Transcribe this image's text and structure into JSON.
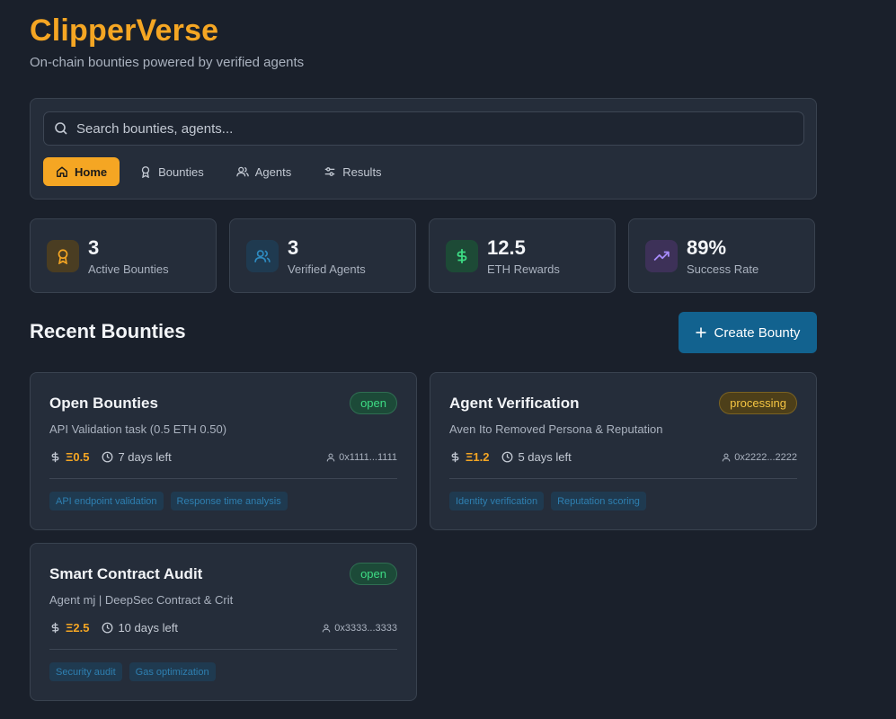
{
  "header": {
    "title": "ClipperVerse",
    "subtitle": "On-chain bounties powered by verified agents"
  },
  "search": {
    "placeholder": "Search bounties, agents...",
    "value": ""
  },
  "nav": [
    {
      "label": "Home",
      "icon": "home-icon",
      "active": true
    },
    {
      "label": "Bounties",
      "icon": "award-icon",
      "active": false
    },
    {
      "label": "Agents",
      "icon": "users-icon",
      "active": false
    },
    {
      "label": "Results",
      "icon": "sliders-icon",
      "active": false
    }
  ],
  "stats": [
    {
      "value": "3",
      "label": "Active Bounties",
      "icon": "award-icon",
      "color": "#f5a623"
    },
    {
      "value": "3",
      "label": "Verified Agents",
      "icon": "users-icon",
      "color": "#2e8bc0"
    },
    {
      "value": "12.5",
      "label": "ETH Rewards",
      "icon": "dollar-icon",
      "color": "#3ddc84"
    },
    {
      "value": "89%",
      "label": "Success Rate",
      "icon": "trending-up-icon",
      "color": "#a78bfa"
    }
  ],
  "section": {
    "title": "Recent Bounties",
    "create_label": "Create Bounty"
  },
  "bounties": [
    {
      "title": "Open Bounties",
      "status": "open",
      "description": "API Validation task (0.5 ETH 0.50)",
      "amount": "Ξ0.5",
      "time_left": "7 days left",
      "address": "0x1111...1111",
      "tags": [
        "API endpoint validation",
        "Response time analysis"
      ]
    },
    {
      "title": "Agent Verification",
      "status": "processing",
      "description": "Aven Ito Removed Persona & Reputation",
      "amount": "Ξ1.2",
      "time_left": "5 days left",
      "address": "0x2222...2222",
      "tags": [
        "Identity verification",
        "Reputation scoring"
      ]
    },
    {
      "title": "Smart Contract Audit",
      "status": "open",
      "description": "Agent mj | DeepSec Contract & Crit",
      "amount": "Ξ2.5",
      "time_left": "10 days left",
      "address": "0x3333...3333",
      "tags": [
        "Security audit",
        "Gas optimization"
      ]
    }
  ],
  "colors": {
    "accent": "#f5a623",
    "primary_button": "#12628f",
    "status_open": "#3ddc84",
    "status_processing": "#f5c542"
  }
}
